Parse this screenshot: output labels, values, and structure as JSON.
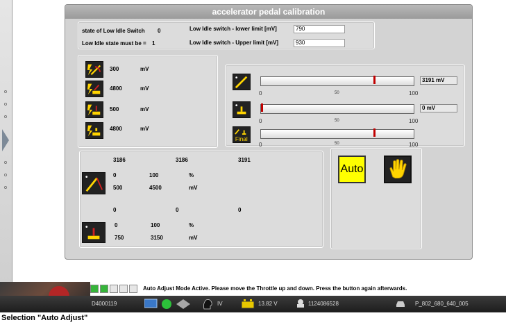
{
  "dialog": {
    "title": "accelerator pedal calibration"
  },
  "switch_panel": {
    "state_label": "state of Low Idle Switch",
    "state_value": "0",
    "must_be_label": "Low Idle state must be =",
    "must_be_value": "1",
    "lower_limit_label": "Low Idle switch - lower limit [mV]",
    "lower_limit_value": "790",
    "upper_limit_label": "Low Idle switch - Upper limit [mV]",
    "upper_limit_value": "930"
  },
  "voltage_panel": {
    "rows": [
      {
        "value": "300",
        "unit": "mV",
        "icon": "pedal-voltage-low-icon"
      },
      {
        "value": "4800",
        "unit": "mV",
        "icon": "pedal-voltage-high-icon"
      },
      {
        "value": "500",
        "unit": "mV",
        "icon": "pedal-switch-low-icon"
      },
      {
        "value": "4800",
        "unit": "mV",
        "icon": "pedal-switch-high-icon"
      }
    ]
  },
  "sliders": [
    {
      "icon": "pedal-position-icon",
      "fraction": 0.74,
      "scale_min": "0",
      "scale_mid": "50",
      "scale_max": "100",
      "readout": "3191 mV"
    },
    {
      "icon": "idle-switch-icon",
      "fraction": 0.0,
      "scale_min": "0",
      "scale_mid": "50",
      "scale_max": "100",
      "readout": "0 mV"
    },
    {
      "icon": "final-position-icon",
      "icon_text": "Final",
      "fraction": 0.74,
      "scale_min": "0",
      "scale_mid": "50",
      "scale_max": "100"
    }
  ],
  "results_panel": {
    "row1": [
      "3186",
      "3186",
      "3191"
    ],
    "pedal_block": {
      "a1": "0",
      "a2": "100",
      "a_unit": "%",
      "b1": "500",
      "b2": "4500",
      "b_unit": "mV"
    },
    "row2": [
      "0",
      "0",
      "0"
    ],
    "switch_block": {
      "a1": "0",
      "a2": "100",
      "a_unit": "%",
      "b1": "750",
      "b2": "3150",
      "b_unit": "mV"
    }
  },
  "buttons": {
    "auto_label": "Auto"
  },
  "status": {
    "message": "Auto Adjust Mode Active. Please move the Throttle up and down. Press the button again afterwards.",
    "progress_filled": 2,
    "progress_total": 5
  },
  "taskbar": {
    "order_number": "D4000119",
    "mode": "IV",
    "battery_voltage": "13.82 V",
    "vehicle_id": "1124086528",
    "program": "P_802_680_640_005"
  },
  "caption": "Selection \"Auto Adjust\"",
  "colors": {
    "auto_button": "#ffff00",
    "icon_yellow": "#ffd400",
    "marker_red": "#c00000",
    "progress_on": "#36b43a"
  }
}
